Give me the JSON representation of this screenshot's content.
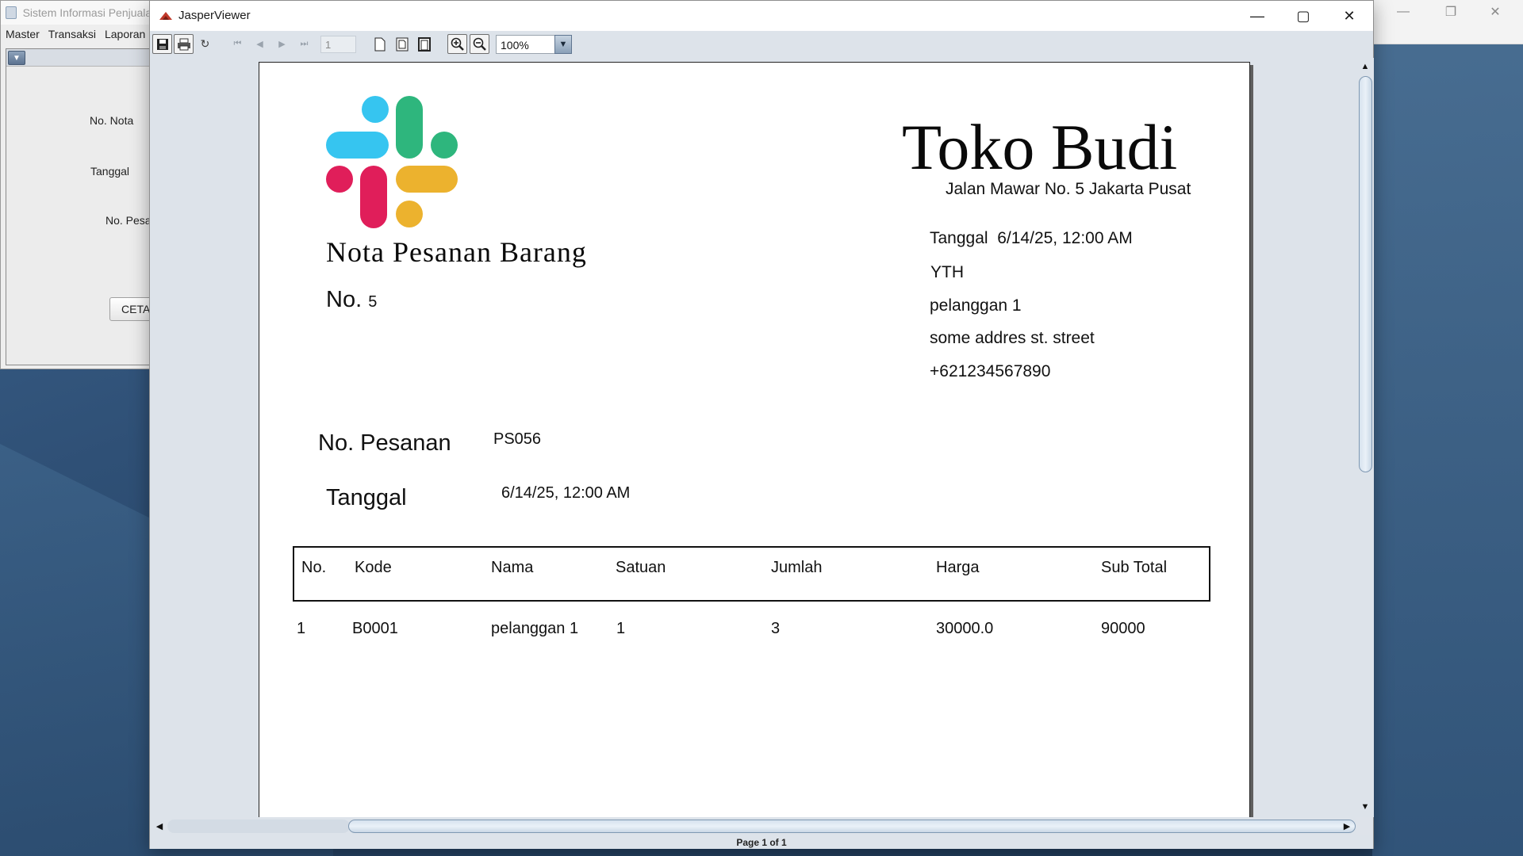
{
  "background_app": {
    "title": "Sistem Informasi Penjualan",
    "menu": [
      "Master",
      "Transaksi",
      "Laporan"
    ],
    "labels": {
      "no_nota": "No. Nota",
      "tanggal": "Tanggal",
      "no_pesanan": "No. Pesanan"
    },
    "cetak_button": "CETAK"
  },
  "viewer": {
    "title": "JasperViewer",
    "toolbar": {
      "page_number": "1",
      "zoom": "100%"
    },
    "status": "Page 1 of 1"
  },
  "report": {
    "logo_colors": [
      "#36C5F0",
      "#2EB67D",
      "#E01E5A",
      "#ECB22E"
    ],
    "store_name": "Toko Budi",
    "store_address": "Jalan Mawar No. 5 Jakarta Pusat",
    "title": "Nota Pesanan Barang",
    "no_label": "No.",
    "no_value": "5",
    "tanggal_label": "Tanggal",
    "tanggal_value": "6/14/25, 12:00 AM",
    "yth": "YTH",
    "customer_name": "pelanggan 1",
    "customer_address": "some addres st. street",
    "customer_phone": "+621234567890",
    "order_no_label": "No. Pesanan",
    "order_no_value": "PS056",
    "order_date_label": "Tanggal",
    "order_date_value": "6/14/25, 12:00 AM",
    "table": {
      "headers": [
        "No.",
        "Kode",
        "Nama",
        "Satuan",
        "Jumlah",
        "Harga",
        "Sub Total"
      ],
      "rows": [
        [
          "1",
          "B0001",
          "pelanggan 1",
          "1",
          "3",
          "30000.0",
          "90000"
        ]
      ]
    }
  }
}
